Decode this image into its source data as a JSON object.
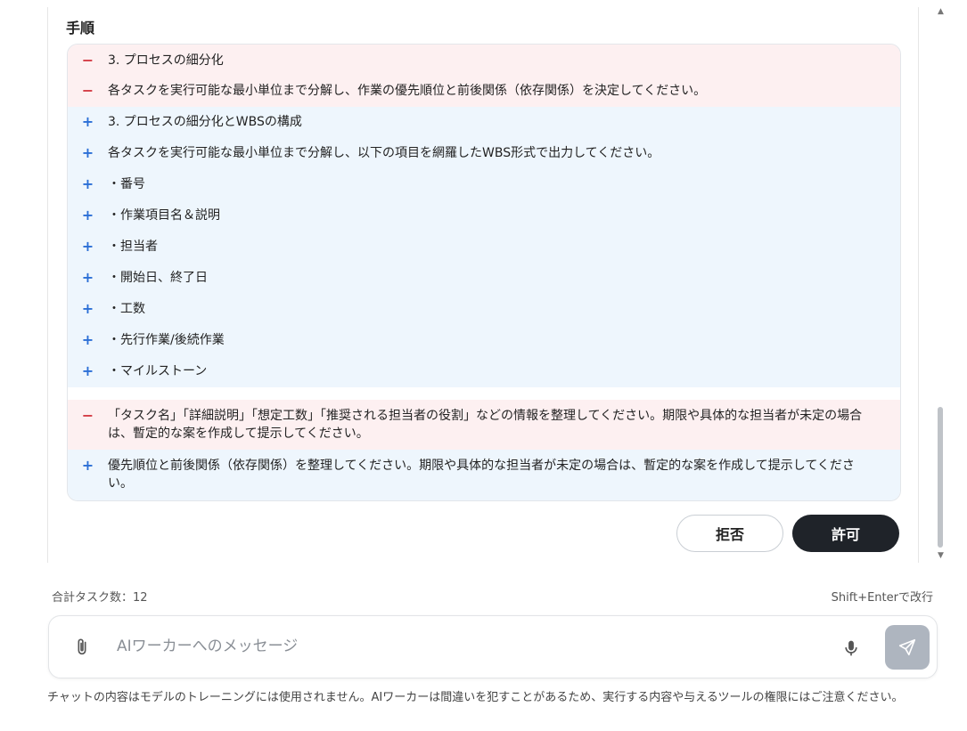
{
  "section_title": "手順",
  "diff_lines": [
    {
      "type": "del",
      "mark": "−",
      "text": "3. プロセスの細分化"
    },
    {
      "type": "del",
      "mark": "−",
      "text": "各タスクを実行可能な最小単位まで分解し、作業の優先順位と前後関係（依存関係）を決定してください。"
    },
    {
      "type": "add",
      "mark": "+",
      "text": "3. プロセスの細分化とWBSの構成"
    },
    {
      "type": "add",
      "mark": "+",
      "text": "各タスクを実行可能な最小単位まで分解し、以下の項目を網羅したWBS形式で出力してください。"
    },
    {
      "type": "add",
      "mark": "+",
      "text": "・番号"
    },
    {
      "type": "add",
      "mark": "+",
      "text": "・作業項目名＆説明"
    },
    {
      "type": "add",
      "mark": "+",
      "text": "・担当者"
    },
    {
      "type": "add",
      "mark": "+",
      "text": "・開始日、終了日"
    },
    {
      "type": "add",
      "mark": "+",
      "text": "・工数"
    },
    {
      "type": "add",
      "mark": "+",
      "text": "・先行作業/後続作業"
    },
    {
      "type": "add",
      "mark": "+",
      "text": "・マイルストーン"
    },
    {
      "type": "del",
      "mark": "−",
      "text": "「タスク名」「詳細説明」「想定工数」「推奨される担当者の役割」などの情報を整理してください。期限や具体的な担当者が未定の場合は、暫定的な案を作成して提示してください。"
    },
    {
      "type": "add",
      "mark": "+",
      "text": "優先順位と前後関係（依存関係）を整理してください。期限や具体的な担当者が未定の場合は、暫定的な案を作成して提示してください。"
    }
  ],
  "buttons": {
    "reject": "拒否",
    "allow": "許可"
  },
  "footer": {
    "task_count": "合計タスク数：12",
    "hint": "Shift+Enterで改行"
  },
  "input": {
    "placeholder": "AIワーカーへのメッセージ",
    "value": ""
  },
  "icons": {
    "attach": "paperclip-icon",
    "mic": "microphone-icon",
    "send": "send-icon"
  },
  "disclaimer": "チャットの内容はモデルのトレーニングには使用されません。AIワーカーは間違いを犯すことがあるため、実行する内容や与えるツールの権限にはご注意ください。",
  "colors": {
    "del_bg": "#fdf0f1",
    "add_bg": "#eef6fd",
    "del_mark": "#d33a43",
    "add_mark": "#2b6fd6",
    "allow_bg": "#1f2329",
    "send_bg": "#aeb5bf"
  }
}
